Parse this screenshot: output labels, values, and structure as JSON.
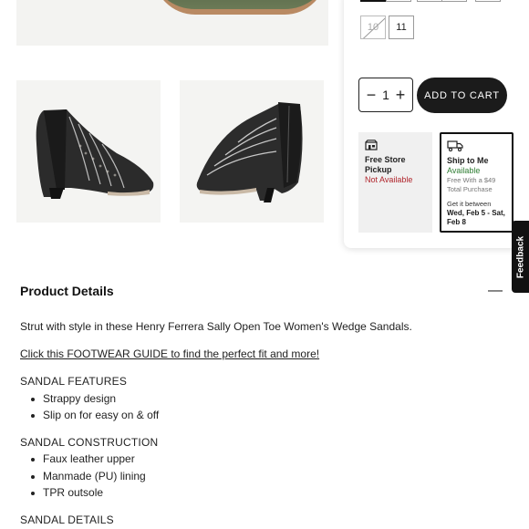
{
  "sizes": [
    {
      "label": "",
      "state": "selected"
    },
    {
      "label": "",
      "state": "available"
    },
    {
      "label": "",
      "state": "available"
    },
    {
      "label": "",
      "state": "available"
    },
    {
      "label": "",
      "state": "available"
    },
    {
      "label": "10",
      "state": "unavailable"
    },
    {
      "label": "11",
      "state": "available"
    }
  ],
  "cart": {
    "quantity": "1",
    "decrement_symbol": "−",
    "increment_symbol": "+",
    "add_label": "ADD TO CART"
  },
  "fulfillment": {
    "pickup": {
      "title": "Free Store Pickup",
      "status": "Not Available"
    },
    "ship": {
      "title": "Ship to Me",
      "status": "Available",
      "note": "Free With a $49 Total Purchase",
      "eta_label": "Get it between",
      "eta_dates": "Wed, Feb 5 - Sat, Feb 8"
    }
  },
  "feedback_label": "Feedback",
  "details": {
    "title": "Product Details",
    "collapse_symbol": "—",
    "description": "Strut with style in these Henry Ferrera Sally Open Toe Women's Wedge Sandals.",
    "guide_link": "Click this FOOTWEAR GUIDE to find the perfect fit and more!",
    "sections": [
      {
        "heading": "SANDAL FEATURES",
        "items": [
          "Strappy design",
          "Slip on for easy on & off"
        ]
      },
      {
        "heading": "SANDAL CONSTRUCTION",
        "items": [
          "Faux leather upper",
          "Manmade (PU) lining",
          "TPR outsole"
        ]
      },
      {
        "heading": "SANDAL DETAILS",
        "items": []
      }
    ]
  },
  "colors": {
    "accent": "#1b1b1b",
    "unavailable": "#b0252c",
    "available": "#2e7d32"
  }
}
